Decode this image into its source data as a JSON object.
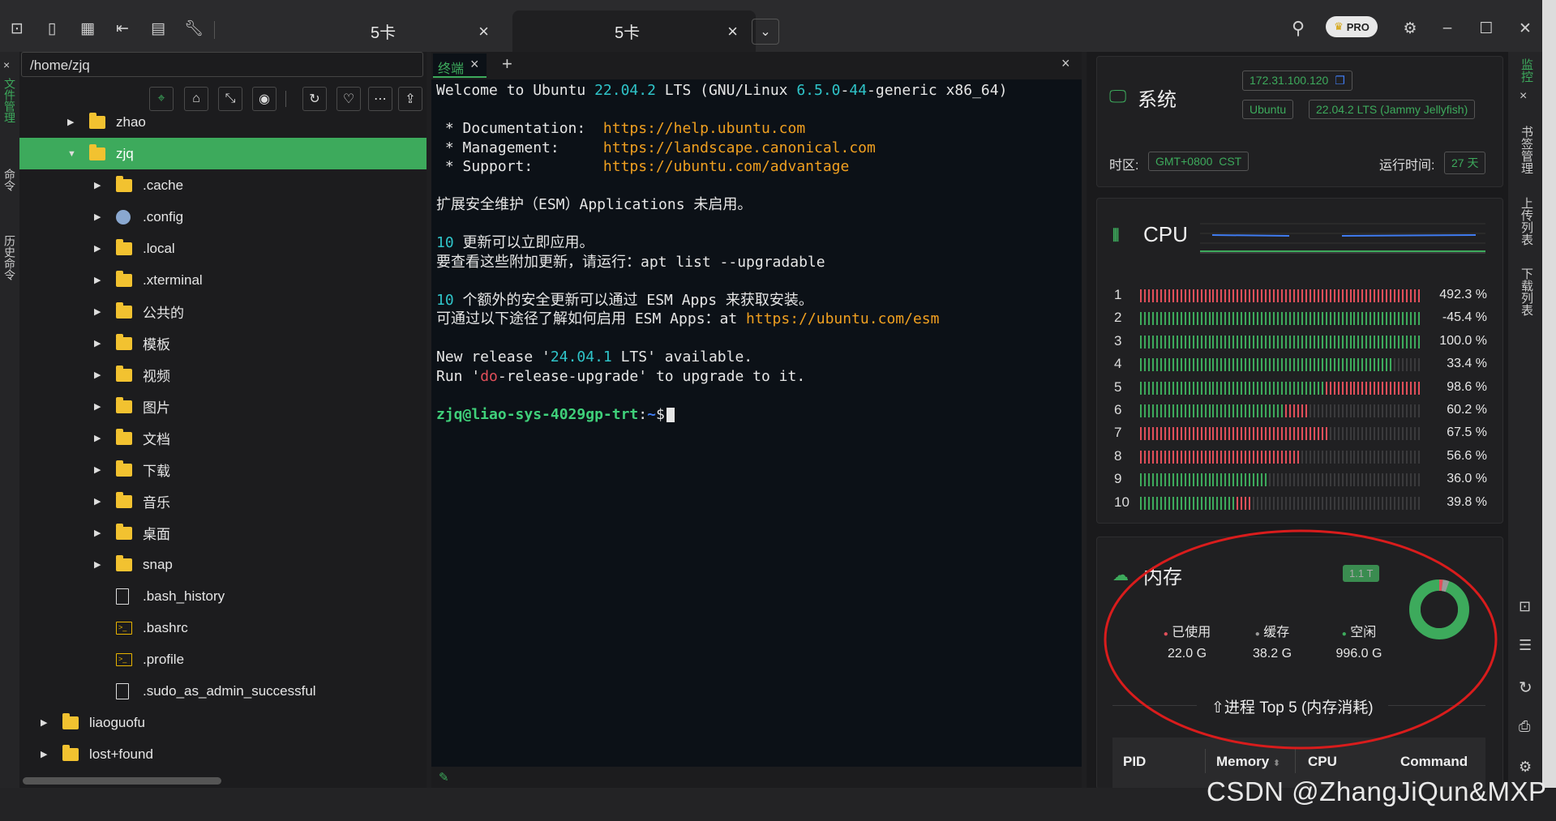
{
  "app": {
    "tabs": [
      {
        "label": "5卡"
      },
      {
        "label": "5卡"
      }
    ],
    "pro_badge": "PRO"
  },
  "left_strip": {
    "items": [
      "文件管理",
      "命令",
      "历史命令"
    ]
  },
  "file_panel": {
    "path": "/home/zjq",
    "tree": [
      {
        "name": "zhao",
        "type": "folder",
        "level": 1,
        "expanded": false,
        "selected": false
      },
      {
        "name": "zjq",
        "type": "folder",
        "level": 1,
        "expanded": true,
        "selected": true
      },
      {
        "name": ".cache",
        "type": "folder",
        "level": 2,
        "expanded": false,
        "selected": false
      },
      {
        "name": ".config",
        "type": "config",
        "level": 2,
        "expanded": false,
        "selected": false
      },
      {
        "name": ".local",
        "type": "folder",
        "level": 2,
        "expanded": false,
        "selected": false
      },
      {
        "name": ".xterminal",
        "type": "folder",
        "level": 2,
        "expanded": false,
        "selected": false
      },
      {
        "name": "公共的",
        "type": "folder",
        "level": 2,
        "expanded": false,
        "selected": false
      },
      {
        "name": "模板",
        "type": "folder",
        "level": 2,
        "expanded": false,
        "selected": false
      },
      {
        "name": "视频",
        "type": "folder",
        "level": 2,
        "expanded": false,
        "selected": false
      },
      {
        "name": "图片",
        "type": "folder",
        "level": 2,
        "expanded": false,
        "selected": false
      },
      {
        "name": "文档",
        "type": "folder",
        "level": 2,
        "expanded": false,
        "selected": false
      },
      {
        "name": "下载",
        "type": "folder",
        "level": 2,
        "expanded": false,
        "selected": false
      },
      {
        "name": "音乐",
        "type": "folder",
        "level": 2,
        "expanded": false,
        "selected": false
      },
      {
        "name": "桌面",
        "type": "folder",
        "level": 2,
        "expanded": false,
        "selected": false
      },
      {
        "name": "snap",
        "type": "folder",
        "level": 2,
        "expanded": false,
        "selected": false
      },
      {
        "name": ".bash_history",
        "type": "file",
        "level": 2,
        "expanded": null,
        "selected": false
      },
      {
        "name": ".bashrc",
        "type": "shell",
        "level": 2,
        "expanded": null,
        "selected": false
      },
      {
        "name": ".profile",
        "type": "shell",
        "level": 2,
        "expanded": null,
        "selected": false
      },
      {
        "name": ".sudo_as_admin_successful",
        "type": "file",
        "level": 2,
        "expanded": null,
        "selected": false
      },
      {
        "name": "liaoguofu",
        "type": "folder",
        "level": 0,
        "expanded": false,
        "selected": false
      },
      {
        "name": "lost+found",
        "type": "folder",
        "level": 0,
        "expanded": false,
        "selected": false
      }
    ]
  },
  "terminal": {
    "tab_label": "终端",
    "lines": [
      [
        [
          "Welcome to Ubuntu ",
          ""
        ],
        [
          "22.04.2",
          "c"
        ],
        [
          " LTS (GNU/Linux ",
          ""
        ],
        [
          "6.5.0",
          "c"
        ],
        [
          "-",
          ""
        ],
        [
          "44",
          "c"
        ],
        [
          "-generic x86_64)",
          ""
        ]
      ],
      [],
      [
        [
          " * Documentation:  ",
          ""
        ],
        [
          "https://help.ubuntu.com",
          "o"
        ]
      ],
      [
        [
          " * Management:     ",
          ""
        ],
        [
          "https://landscape.canonical.com",
          "o"
        ]
      ],
      [
        [
          " * Support:        ",
          ""
        ],
        [
          "https://ubuntu.com/advantage",
          "o"
        ]
      ],
      [],
      [
        [
          "扩展安全维护（ESM）Applications 未启用。",
          ""
        ]
      ],
      [],
      [
        [
          "10",
          "c"
        ],
        [
          " 更新可以立即应用。",
          ""
        ]
      ],
      [
        [
          "要查看这些附加更新，请运行：apt list --upgradable",
          ""
        ]
      ],
      [],
      [
        [
          "10",
          "c"
        ],
        [
          " 个额外的安全更新可以通过 ESM Apps 来获取安装。",
          ""
        ]
      ],
      [
        [
          "可通过以下途径了解如何启用 ESM Apps：at ",
          ""
        ],
        [
          "https://ubuntu.com/esm",
          "o"
        ]
      ],
      [],
      [
        [
          "New release '",
          ""
        ],
        [
          "24.04.1",
          "c"
        ],
        [
          " LTS' available.",
          ""
        ]
      ],
      [
        [
          "Run '",
          ""
        ],
        [
          "do",
          "u"
        ],
        [
          "-release-upgrade' to upgrade to it.",
          ""
        ]
      ],
      [],
      [
        [
          "zjq@liao-sys-4029gp-trt",
          "g"
        ],
        [
          ":",
          ""
        ],
        [
          "~",
          "b"
        ],
        [
          "$",
          ""
        ]
      ]
    ]
  },
  "system": {
    "title": "系统",
    "ip": "172.31.100.120",
    "os": "Ubuntu",
    "version": "22.04.2 LTS (Jammy Jellyfish)",
    "tz_label": "时区:",
    "tz_value": "GMT+0800  CST",
    "uptime_label": "运行时间:",
    "uptime_value": "27 天"
  },
  "cpu": {
    "title": "CPU",
    "cores": [
      {
        "id": "1",
        "value": "492.3 %",
        "fill": 1.0,
        "red": true
      },
      {
        "id": "2",
        "value": "-45.4 %",
        "fill": 1.0,
        "red": false
      },
      {
        "id": "3",
        "value": "100.0 %",
        "fill": 1.0,
        "red": false
      },
      {
        "id": "4",
        "value": "33.4 %",
        "fill": 0.9,
        "red": false
      },
      {
        "id": "5",
        "value": "98.6 %",
        "fill": 1.0,
        "red": true
      },
      {
        "id": "6",
        "value": "60.2 %",
        "fill": 0.6,
        "red": true
      },
      {
        "id": "7",
        "value": "67.5 %",
        "fill": 0.675,
        "red": true
      },
      {
        "id": "8",
        "value": "56.6 %",
        "fill": 0.566,
        "red": true
      },
      {
        "id": "9",
        "value": "36.0 %",
        "fill": 0.45,
        "red": false
      },
      {
        "id": "10",
        "value": "39.8 %",
        "fill": 0.4,
        "red": true
      }
    ]
  },
  "memory": {
    "title": "内存",
    "total": "1.1 T",
    "used_label": "已使用",
    "used_value": "22.0 G",
    "used_color": "#e14f5a",
    "cache_label": "缓存",
    "cache_value": "38.2 G",
    "cache_color": "#9a9a9a",
    "free_label": "空闲",
    "free_value": "996.0 G",
    "free_color": "#3daa5c",
    "used_fraction": 0.02,
    "cache_fraction": 0.034,
    "top_title": "⇧进程 Top 5 (内存消耗)",
    "headers": [
      "PID",
      "Memory",
      "CPU",
      "Command"
    ]
  },
  "right_strip": {
    "items": [
      "监控",
      "书签管理",
      "上传列表",
      "下载列表"
    ]
  },
  "watermark": "CSDN @ZhangJiQun&MXP",
  "colors": {
    "accent": "#3daa5c",
    "red": "#e14f5a",
    "terminal_bg": "#0c1117"
  }
}
